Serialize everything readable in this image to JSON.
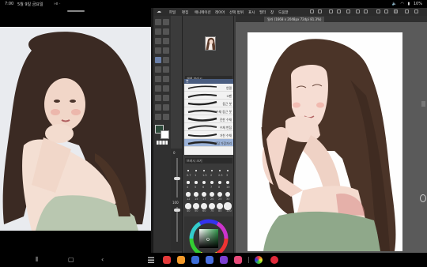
{
  "status_bar": {
    "time": "7:00",
    "date": "5월 9일 금요일",
    "extra": "♭e ·",
    "battery": "10%",
    "icons": [
      "sound-icon",
      "wifi-icon",
      "battery-icon"
    ]
  },
  "gallery": {
    "image_subject": "reference-portrait"
  },
  "app": {
    "menus": [
      "파일",
      "편집",
      "애니메이션",
      "레이어",
      "선택 범위",
      "표시",
      "필터",
      "창",
      "도움말"
    ],
    "canvas_tab": "일러 (1668 x 2048px 72dpi 81.3%)",
    "panels": {
      "sub_tool_title": "붓",
      "brush_group": "채색 브러시",
      "brush_size_title": "브러시 크기",
      "brushes": [
        "연필",
        "G펜",
        "둥근 붓",
        "수채 둥근 붓",
        "진한 수채",
        "수채 번짐",
        "거친 수채",
        "번짐 가장자리"
      ],
      "size_values": [
        "0.7",
        "1",
        "1.5",
        "2",
        "2.5",
        "3",
        "4",
        "5",
        "6",
        "7",
        "8",
        "10",
        "12",
        "15",
        "17",
        "20",
        "25",
        "30",
        "40",
        "50",
        "60",
        "70",
        "80",
        "100"
      ],
      "color_values": "HSV"
    },
    "brush_size_label": "0",
    "zoom_label": "100"
  },
  "nav_bar": {
    "buttons": [
      "recent-apps",
      "home",
      "back"
    ],
    "dock_apps": [
      "app-1",
      "app-2",
      "app-3",
      "app-4",
      "app-5",
      "app-6",
      "app-7",
      "app-8",
      "app-9"
    ]
  },
  "colors": {
    "app_bg": "#3b3b3b",
    "accent_green": "#8fa88a",
    "skin": "#f2d9cf",
    "hair": "#4a3326"
  }
}
